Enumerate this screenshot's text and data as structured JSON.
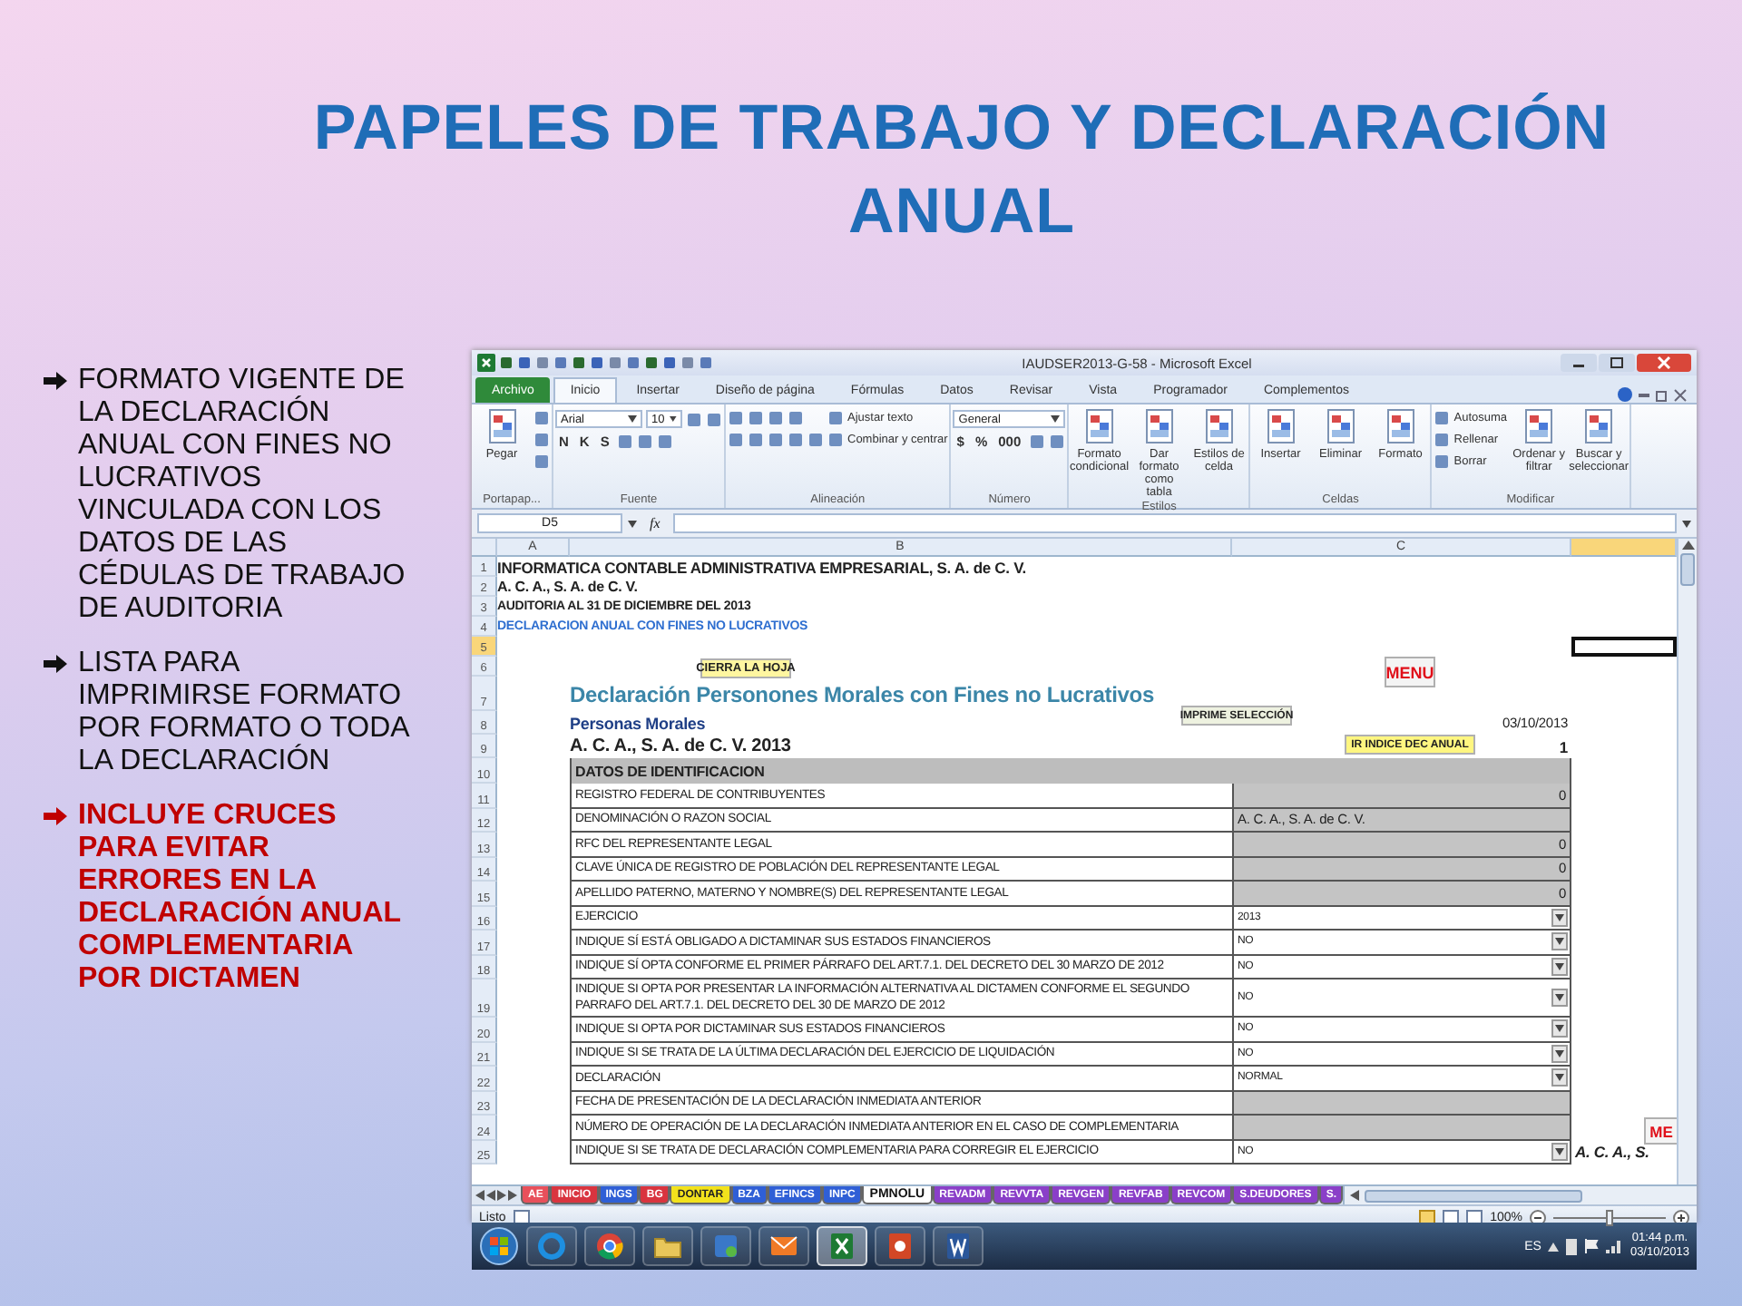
{
  "slide": {
    "title": "PAPELES DE TRABAJO Y DECLARACIÓN ANUAL",
    "bullets": [
      {
        "text": "FORMATO VIGENTE DE LA DECLARACIÓN ANUAL CON FINES NO LUCRATIVOS VINCULADA CON LOS DATOS DE LAS CÉDULAS DE TRABAJO DE AUDITORIA",
        "emphasis": false
      },
      {
        "text": "LISTA PARA IMPRIMIRSE FORMATO POR FORMATO O TODA LA DECLARACIÓN",
        "emphasis": false
      },
      {
        "text": "INCLUYE CRUCES PARA EVITAR ERRORES EN LA DECLARACIÓN ANUAL COMPLEMENTARIA POR DICTAMEN",
        "emphasis": true
      }
    ]
  },
  "excel": {
    "title": "IAUDSER2013-G-58 - Microsoft Excel",
    "tabs": [
      {
        "label": "Archivo",
        "kind": "file",
        "selected": false
      },
      {
        "label": "Inicio",
        "kind": "tab",
        "selected": true
      },
      {
        "label": "Insertar",
        "kind": "tab",
        "selected": false
      },
      {
        "label": "Diseño de página",
        "kind": "tab",
        "selected": false
      },
      {
        "label": "Fórmulas",
        "kind": "tab",
        "selected": false
      },
      {
        "label": "Datos",
        "kind": "tab",
        "selected": false
      },
      {
        "label": "Revisar",
        "kind": "tab",
        "selected": false
      },
      {
        "label": "Vista",
        "kind": "tab",
        "selected": false
      },
      {
        "label": "Programador",
        "kind": "tab",
        "selected": false
      },
      {
        "label": "Complementos",
        "kind": "tab",
        "selected": false
      }
    ],
    "ribbon": [
      {
        "label": "Portapap...",
        "controls": [
          {
            "kind": "big",
            "label": "Pegar"
          },
          {
            "kind": "column",
            "rows": [
              [
                {
                  "kind": "icon"
                }
              ],
              [
                {
                  "kind": "icon"
                }
              ],
              [
                {
                  "kind": "icon"
                }
              ]
            ]
          }
        ]
      },
      {
        "label": "Fuente",
        "controls": [
          {
            "kind": "column",
            "rows": [
              [
                {
                  "kind": "field",
                  "value": "Arial"
                },
                {
                  "kind": "field",
                  "value": "10"
                },
                {
                  "kind": "icon"
                },
                {
                  "kind": "icon"
                }
              ],
              [
                {
                  "kind": "glyph",
                  "label": "N"
                },
                {
                  "kind": "glyph",
                  "label": "K"
                },
                {
                  "kind": "glyph",
                  "label": "S"
                },
                {
                  "kind": "icon"
                },
                {
                  "kind": "icon"
                },
                {
                  "kind": "icon"
                }
              ]
            ]
          }
        ]
      },
      {
        "label": "Alineación",
        "controls": [
          {
            "kind": "column",
            "rows": [
              [
                {
                  "kind": "icon"
                },
                {
                  "kind": "icon"
                },
                {
                  "kind": "icon"
                },
                {
                  "kind": "icon"
                }
              ],
              [
                {
                  "kind": "icon"
                },
                {
                  "kind": "icon"
                },
                {
                  "kind": "icon"
                },
                {
                  "kind": "icon"
                },
                {
                  "kind": "icon"
                }
              ]
            ]
          },
          {
            "kind": "column",
            "rows": [
              [
                {
                  "kind": "small",
                  "label": "Ajustar texto"
                }
              ],
              [
                {
                  "kind": "small",
                  "label": "Combinar y centrar"
                }
              ]
            ]
          }
        ]
      },
      {
        "label": "Número",
        "controls": [
          {
            "kind": "column",
            "rows": [
              [
                {
                  "kind": "field",
                  "value": "General"
                }
              ],
              [
                {
                  "kind": "glyph",
                  "label": "$"
                },
                {
                  "kind": "glyph",
                  "label": "%"
                },
                {
                  "kind": "glyph",
                  "label": "000"
                },
                {
                  "kind": "icon"
                },
                {
                  "kind": "icon"
                }
              ]
            ]
          }
        ]
      },
      {
        "label": "Estilos",
        "controls": [
          {
            "kind": "big",
            "label": "Formato condicional"
          },
          {
            "kind": "big",
            "label": "Dar formato como tabla"
          },
          {
            "kind": "big",
            "label": "Estilos de celda"
          }
        ]
      },
      {
        "label": "Celdas",
        "controls": [
          {
            "kind": "big",
            "label": "Insertar"
          },
          {
            "kind": "big",
            "label": "Eliminar"
          },
          {
            "kind": "big",
            "label": "Formato"
          }
        ]
      },
      {
        "label": "Modificar",
        "controls": [
          {
            "kind": "column",
            "rows": [
              [
                {
                  "kind": "small",
                  "label": "Autosuma"
                }
              ],
              [
                {
                  "kind": "small",
                  "label": "Rellenar"
                }
              ],
              [
                {
                  "kind": "small",
                  "label": "Borrar"
                }
              ]
            ]
          },
          {
            "kind": "big",
            "label": "Ordenar y filtrar"
          },
          {
            "kind": "big",
            "label": "Buscar y seleccionar"
          }
        ]
      }
    ],
    "name_box": "D5",
    "formula_mark": "fx",
    "columns": [
      {
        "label": "A",
        "selected": false
      },
      {
        "label": "B",
        "selected": false
      },
      {
        "label": "C",
        "selected": false
      },
      {
        "selected": true
      }
    ],
    "rows": [
      {
        "number": "1",
        "kind": "company",
        "text": "INFORMATICA CONTABLE ADMINISTRATIVA EMPRESARIAL, S. A. de C. V.",
        "selected": false
      },
      {
        "number": "2",
        "kind": "entity",
        "text": "A. C. A., S. A. de C. V.",
        "selected": false
      },
      {
        "number": "3",
        "kind": "note",
        "text": "AUDITORIA AL 31 DE DICIEMBRE DEL 2013",
        "selected": false
      },
      {
        "number": "4",
        "kind": "subtitle",
        "text": "DECLARACION ANUAL CON FINES NO LUCRATIVOS",
        "selected": false
      },
      {
        "number": "5",
        "kind": "blank",
        "selected": true
      },
      {
        "number": "6",
        "kind": "blank",
        "selected": false
      },
      {
        "number": "7",
        "kind": "title",
        "text": "Declaración Personones Morales con Fines no Lucrativos",
        "selected": false
      },
      {
        "number": "8",
        "kind": "section",
        "text": "Personas Morales",
        "aside": "03/10/2013",
        "selected": false
      },
      {
        "number": "9",
        "kind": "entity_large",
        "text": "A. C. A., S. A. de C. V. 2013",
        "aside": "1",
        "selected": false
      },
      {
        "number": "10",
        "kind": "header",
        "text": "DATOS DE IDENTIFICACION",
        "selected": false
      },
      {
        "number": "11",
        "kind": "field",
        "text": "REGISTRO FEDERAL DE CONTRIBUYENTES",
        "cell": {
          "kind": "number",
          "value": "0"
        },
        "selected": false
      },
      {
        "number": "12",
        "kind": "field",
        "text": "DENOMINACIÓN O RAZON SOCIAL",
        "cell": {
          "kind": "text",
          "value": "A. C. A., S. A. de C. V."
        },
        "selected": false
      },
      {
        "number": "13",
        "kind": "field",
        "text": "RFC DEL REPRESENTANTE LEGAL",
        "cell": {
          "kind": "number",
          "value": "0"
        },
        "selected": false
      },
      {
        "number": "14",
        "kind": "field",
        "text": "CLAVE ÚNICA DE REGISTRO DE POBLACIÓN DEL REPRESENTANTE LEGAL",
        "cell": {
          "kind": "number",
          "value": "0"
        },
        "selected": false
      },
      {
        "number": "15",
        "kind": "field",
        "text": "APELLIDO PATERNO, MATERNO Y NOMBRE(S) DEL REPRESENTANTE LEGAL",
        "cell": {
          "kind": "number",
          "value": "0"
        },
        "selected": false
      },
      {
        "number": "16",
        "kind": "field",
        "text": "EJERCICIO",
        "cell": {
          "kind": "dropdown",
          "value": "2013"
        },
        "selected": false
      },
      {
        "number": "17",
        "kind": "field",
        "text": "INDIQUE SÍ ESTÁ OBLIGADO A DICTAMINAR SUS ESTADOS FINANCIEROS",
        "cell": {
          "kind": "dropdown",
          "value": "NO"
        },
        "selected": false
      },
      {
        "number": "18",
        "kind": "field",
        "text": "INDIQUE SÍ OPTA CONFORME EL PRIMER PÁRRAFO DEL ART.7.1. DEL DECRETO DEL 30 MARZO DE 2012",
        "cell": {
          "kind": "dropdown",
          "value": "NO"
        },
        "selected": false
      },
      {
        "number": "19",
        "kind": "field",
        "text": "INDIQUE SI OPTA POR PRESENTAR LA INFORMACIÓN ALTERNATIVA AL DICTAMEN CONFORME EL SEGUNDO PARRAFO DEL ART.7.1. DEL DECRETO DEL 30 DE MARZO DE 2012",
        "cell": {
          "kind": "dropdown",
          "value": "NO"
        },
        "selected": false
      },
      {
        "number": "20",
        "kind": "field",
        "text": "INDIQUE SI OPTA POR DICTAMINAR SUS ESTADOS FINANCIEROS",
        "cell": {
          "kind": "dropdown",
          "value": "NO"
        },
        "selected": false
      },
      {
        "number": "21",
        "kind": "field",
        "text": "INDIQUE SI SE TRATA DE LA ÚLTIMA DECLARACIÓN DEL EJERCICIO DE LIQUIDACIÓN",
        "cell": {
          "kind": "dropdown",
          "value": "NO"
        },
        "selected": false
      },
      {
        "number": "22",
        "kind": "field",
        "text": "DECLARACIÓN",
        "cell": {
          "kind": "dropdown",
          "value": "NORMAL"
        },
        "selected": false
      },
      {
        "number": "23",
        "kind": "field",
        "text": "FECHA DE PRESENTACIÓN DE LA DECLARACIÓN INMEDIATA ANTERIOR",
        "cell": {
          "kind": "empty"
        },
        "selected": false
      },
      {
        "number": "24",
        "kind": "field",
        "text": "NÚMERO DE OPERACIÓN DE LA DECLARACIÓN INMEDIATA ANTERIOR EN EL CASO DE COMPLEMENTARIA",
        "cell": {
          "kind": "empty"
        },
        "selected": false
      },
      {
        "number": "25",
        "kind": "field",
        "text": "INDIQUE SI SE TRATA DE DECLARACIÓN COMPLEMENTARIA PARA CORREGIR EL EJERCICIO",
        "cell": {
          "kind": "dropdown",
          "value": "NO"
        },
        "overflow": "A. C. A., S.",
        "selected": false
      }
    ],
    "sheet_buttons": [
      {
        "kind": "close",
        "label": "CIERRA LA HOJA"
      },
      {
        "kind": "menu",
        "label": "MENU"
      },
      {
        "kind": "print",
        "label": "IMPRIME SELECCIÓN"
      },
      {
        "kind": "index",
        "label": "IR INDICE DEC ANUAL"
      },
      {
        "kind": "menu_cut",
        "label": "ME"
      }
    ],
    "sheet_tabs": [
      {
        "label": "AE",
        "color": "#e8505b",
        "selected": false
      },
      {
        "label": "INICIO",
        "color": "#d9343f",
        "selected": false
      },
      {
        "label": "INGS",
        "color": "#2f5fd6",
        "selected": false
      },
      {
        "label": "BG",
        "color": "#d9343f",
        "selected": false
      },
      {
        "label": "DONTAR",
        "color": "#f2e21c",
        "selected": false
      },
      {
        "label": "BZA",
        "color": "#2f5fd6",
        "selected": false
      },
      {
        "label": "EFINCS",
        "color": "#2f5fd6",
        "selected": false
      },
      {
        "label": "INPC",
        "color": "#2f5fd6",
        "selected": false
      },
      {
        "label": "PMNOLU",
        "color": "#ffffff",
        "selected": true
      },
      {
        "label": "REVADM",
        "color": "#8a3fc8",
        "selected": false
      },
      {
        "label": "REVVTA",
        "color": "#8a3fc8",
        "selected": false
      },
      {
        "label": "REVGEN",
        "color": "#8a3fc8",
        "selected": false
      },
      {
        "label": "REVFAB",
        "color": "#8a3fc8",
        "selected": false
      },
      {
        "label": "REVCOM",
        "color": "#8a3fc8",
        "selected": false
      },
      {
        "label": "S.DEUDORES",
        "color": "#8a3fc8",
        "selected": false
      },
      {
        "label": "S.",
        "color": "#8a3fc8",
        "selected": false
      }
    ],
    "status": {
      "text": "Listo",
      "zoom": "100%",
      "level": 0.5
    }
  },
  "taskbar": {
    "apps": [
      {
        "kind": "ie",
        "selected": false
      },
      {
        "kind": "chrome",
        "selected": false
      },
      {
        "kind": "folder",
        "selected": false
      },
      {
        "kind": "lync",
        "selected": false
      },
      {
        "kind": "mail",
        "selected": false
      },
      {
        "kind": "excel",
        "selected": true
      },
      {
        "kind": "powerpoint",
        "selected": false
      },
      {
        "kind": "word",
        "selected": false
      }
    ],
    "language": "ES",
    "time": "01:44 p.m.",
    "date": "03/10/2013"
  }
}
